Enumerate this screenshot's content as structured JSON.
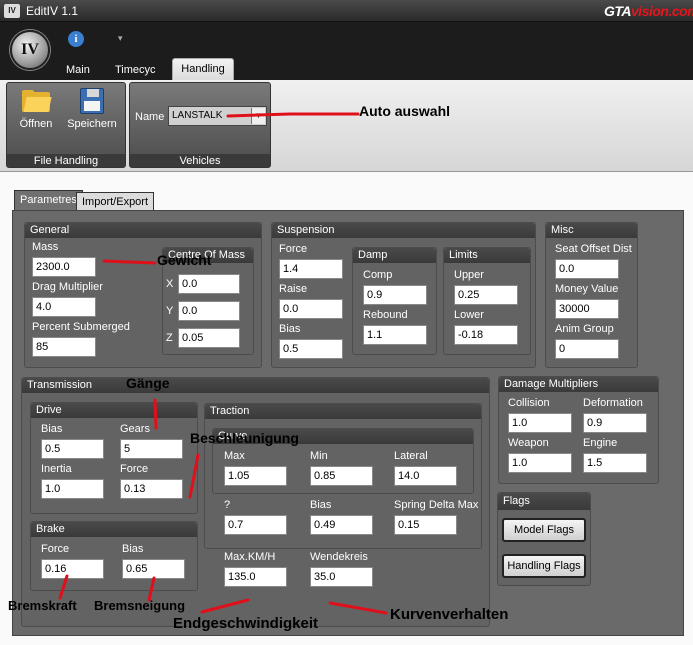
{
  "window": {
    "app_icon": "IV",
    "title": "EditIV 1.1",
    "site_logo_a": "GTA",
    "site_logo_b": "vision.com"
  },
  "orb": {
    "label": "IV"
  },
  "quick_access": {
    "info_icon": "i",
    "arrow_icon": "▾"
  },
  "tabs": [
    {
      "label": "Main"
    },
    {
      "label": "Timecyc"
    },
    {
      "label": "Handling"
    }
  ],
  "ribbon": {
    "file_group": {
      "label": "File Handling",
      "open_label": "Öffnen",
      "save_label": "Speichern"
    },
    "vehicles_group": {
      "label": "Vehicles",
      "name_label": "Name",
      "vehicle": "LANSTALK"
    }
  },
  "subtabs": [
    {
      "label": "Parametres"
    },
    {
      "label": "Import/Export"
    }
  ],
  "general": {
    "title": "General",
    "mass_label": "Mass",
    "mass": "2300.0",
    "drag_label": "Drag Multiplier",
    "drag": "4.0",
    "submerged_label": "Percent Submerged",
    "submerged": "85",
    "centre_title": "Centre Of Mass",
    "x_label": "X",
    "x": "0.0",
    "y_label": "Y",
    "y": "0.0",
    "z_label": "Z",
    "z": "0.05"
  },
  "suspension": {
    "title": "Suspension",
    "force_label": "Force",
    "force": "1.4",
    "raise_label": "Raise",
    "raise": "0.0",
    "bias_label": "Bias",
    "bias": "0.5",
    "damp_title": "Damp",
    "comp_label": "Comp",
    "comp": "0.9",
    "rebound_label": "Rebound",
    "rebound": "1.1",
    "limits_title": "Limits",
    "upper_label": "Upper",
    "upper": "0.25",
    "lower_label": "Lower",
    "lower": "-0.18"
  },
  "misc": {
    "title": "Misc",
    "seat_label": "Seat Offset Dist",
    "seat": "0.0",
    "money_label": "Money Value",
    "money": "30000",
    "anim_label": "Anim Group",
    "anim": "0"
  },
  "transmission": {
    "title": "Transmission",
    "drive_title": "Drive",
    "bias_label": "Bias",
    "bias": "0.5",
    "gears_label": "Gears",
    "gears": "5",
    "inertia_label": "Inertia",
    "inertia": "1.0",
    "force_label": "Force",
    "force": "0.13",
    "brake_title": "Brake",
    "brake_force_label": "Force",
    "brake_force": "0.16",
    "brake_bias_label": "Bias",
    "brake_bias": "0.65",
    "traction_title": "Traction",
    "curve_title": "Curve",
    "max_label": "Max",
    "max": "1.05",
    "min_label": "Min",
    "min": "0.85",
    "lateral_label": "Lateral",
    "lateral": "14.0",
    "q_label": "?",
    "q": "0.7",
    "tbias_label": "Bias",
    "tbias": "0.49",
    "spring_label": "Spring Delta Max",
    "spring": "0.15",
    "maxkmh_label": "Max.KM/H",
    "maxkmh": "135.0",
    "wende_label": "Wendekreis",
    "wende": "35.0"
  },
  "damage": {
    "title": "Damage Multipliers",
    "collision_label": "Collision",
    "collision": "1.0",
    "deformation_label": "Deformation",
    "deformation": "0.9",
    "weapon_label": "Weapon",
    "weapon": "1.0",
    "engine_label": "Engine",
    "engine": "1.5"
  },
  "flags": {
    "title": "Flags",
    "model_label": "Model Flags",
    "handling_label": "Handling Flags"
  },
  "annotations": {
    "auto": "Auto auswahl",
    "gewicht": "Gewicht",
    "gaenge": "Gänge",
    "beschleunigung": "Beschleunigung",
    "bremskraft": "Bremskraft",
    "bremsneigung": "Bremsneigung",
    "endgeschwindigkeit": "Endgeschwindigkeit",
    "kurvenverhalten": "Kurvenverhalten",
    "color": "#e0101a"
  }
}
